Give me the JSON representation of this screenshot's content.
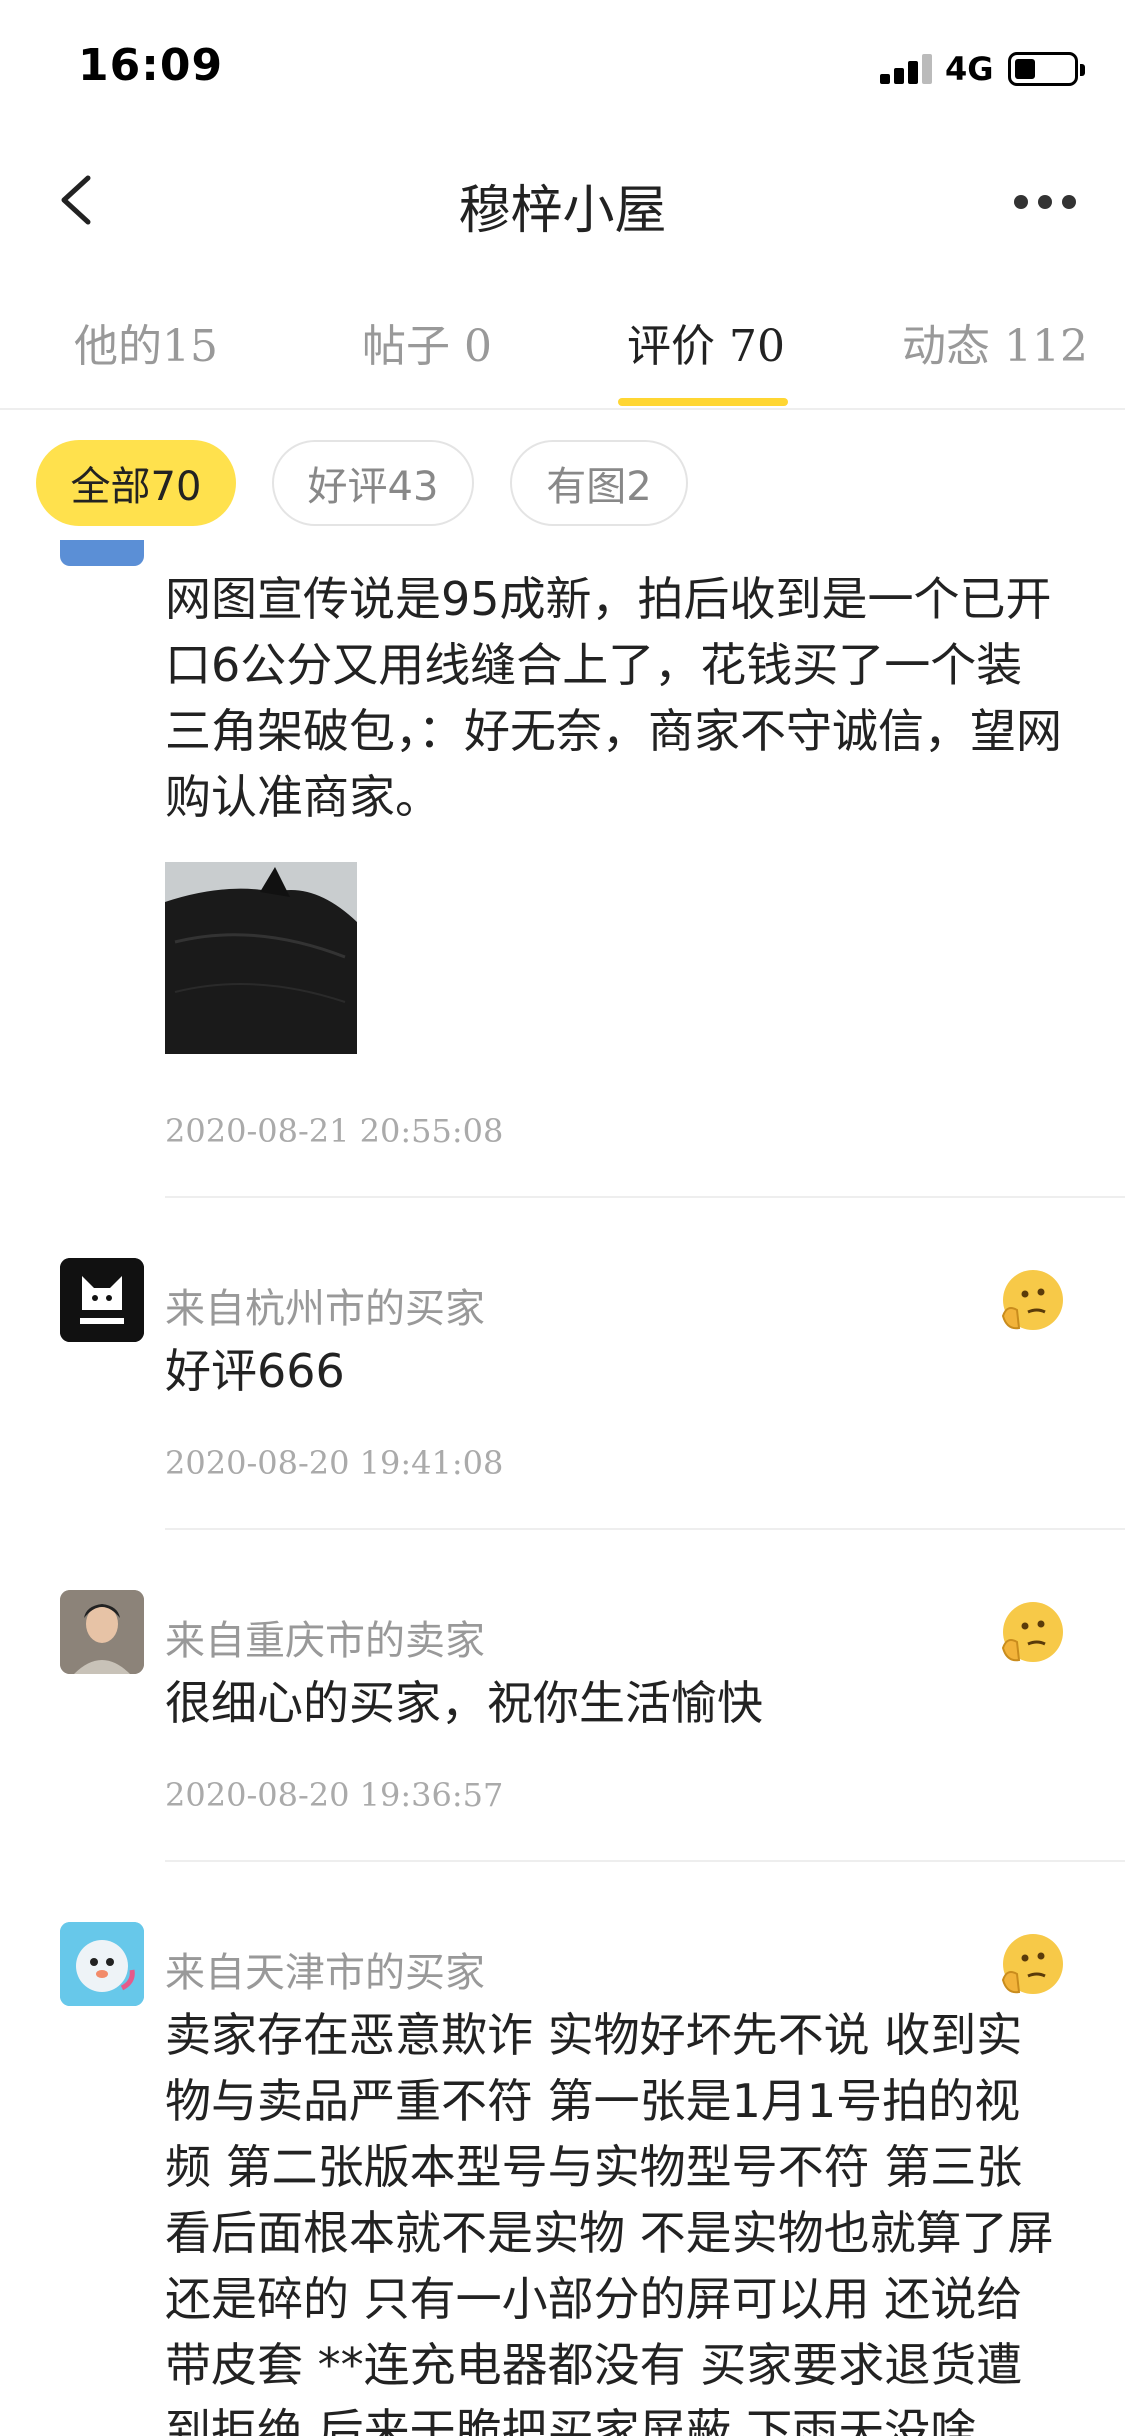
{
  "status": {
    "time": "16:09",
    "network": "4G"
  },
  "nav": {
    "title": "穆梓小屋"
  },
  "tabs": [
    {
      "label": "他的15"
    },
    {
      "label": "帖子 0"
    },
    {
      "label": "评价 70"
    },
    {
      "label": "动态 112"
    }
  ],
  "filters": [
    {
      "label": "全部70"
    },
    {
      "label": "好评43"
    },
    {
      "label": "有图2"
    }
  ],
  "reviews": [
    {
      "text": "网图宣传说是95成新，拍后收到是一个已开口6公分又用线缝合上了，花钱买了一个装三角架破包，：好无奈，商家不守诚信，望网购认准商家。",
      "time": "2020-08-21 20:55:08"
    },
    {
      "from": "来自杭州市的买家",
      "text": "好评666",
      "time": "2020-08-20 19:41:08"
    },
    {
      "from": "来自重庆市的卖家",
      "text": "很细心的买家，祝你生活愉快",
      "time": "2020-08-20 19:36:57"
    },
    {
      "from": "来自天津市的买家",
      "text": "卖家存在恶意欺诈 实物好坏先不说 收到实物与卖品严重不符 第一张是1月1号拍的视频 第二张版本型号与实物型号不符 第三张看后面根本就不是实物 不是实物也就算了屏还是碎的 只有一小部分的屏可以用 还说给带皮套 **连充电器都没有 买家要求退货遭到拒绝 后来干脆把买家屏蔽 下雨天没啥"
    }
  ],
  "colors": {
    "accent": "#ffd633",
    "chip_active": "#ffe14d"
  },
  "icons": {
    "back": "chevron-left-icon",
    "more": "more-dots-icon",
    "rating": "thinking-face-emoji"
  }
}
